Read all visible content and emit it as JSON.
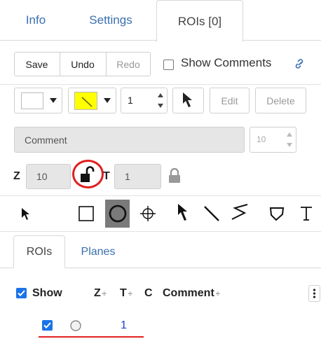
{
  "tabs": [
    {
      "label": "Info"
    },
    {
      "label": "Settings"
    },
    {
      "label": "ROIs [0]"
    }
  ],
  "toolbar": {
    "save": "Save",
    "undo": "Undo",
    "redo": "Redo",
    "show_comments": "Show Comments",
    "line_width": "1",
    "edit": "Edit",
    "delete": "Delete"
  },
  "comment": {
    "placeholder": "Comment",
    "font_size": "10"
  },
  "zt": {
    "z_label": "Z",
    "z_value": "10",
    "t_label": "T",
    "t_value": "1"
  },
  "subtabs": [
    {
      "label": "ROIs"
    },
    {
      "label": "Planes"
    }
  ],
  "table": {
    "show": "Show",
    "z": "Z",
    "t": "T",
    "c": "C",
    "comment": "Comment",
    "row_id": "1"
  },
  "colors": {
    "accent": "#3a6fb0",
    "stroke_color": "#ffff00",
    "highlight": "#e02020",
    "checkbox": "#1a73e8"
  }
}
